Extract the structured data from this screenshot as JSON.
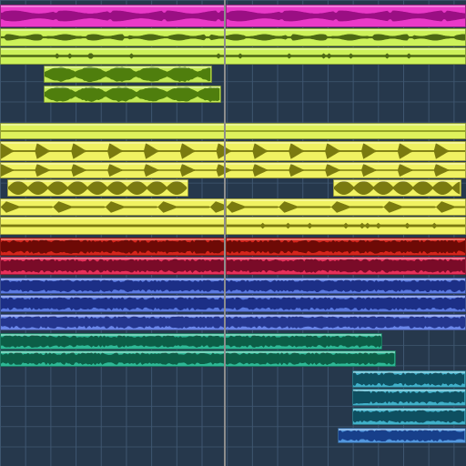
{
  "app": {
    "view": "arrangement",
    "playhead_position": 0.48
  },
  "colors": {
    "background": "#26384c",
    "grid_line": "#3e5670",
    "playhead": "#8d8d8d"
  },
  "tracks": [
    {
      "color": "#ea39c8",
      "wave": "#9a0f83",
      "style": "sustain",
      "regions": [
        {
          "start": 0.0,
          "end": 0.485
        },
        {
          "start": 0.485,
          "end": 1.0
        }
      ]
    },
    {
      "color": "#cdf25a",
      "wave": "#4d6814",
      "style": "flat",
      "regions": [
        {
          "start": 0.0,
          "end": 1.0
        }
      ]
    },
    {
      "color": "#cdf25a",
      "wave": "#4d6814",
      "style": "thin",
      "regions": [
        {
          "start": 0.0,
          "end": 1.0
        }
      ]
    },
    {
      "color": "#c4ea55",
      "wave": "#4f7e0d",
      "style": "blob",
      "regions": [
        {
          "start": 0.093,
          "end": 0.455
        }
      ]
    },
    {
      "color": "#c4ea55",
      "wave": "#4f7e0d",
      "style": "blob",
      "regions": [
        {
          "start": 0.093,
          "end": 0.475
        }
      ]
    },
    {
      "color": "#dff25c",
      "wave": "#7e8d16",
      "style": "empty",
      "regions": [
        {
          "start": 0.0,
          "end": 1.0
        }
      ]
    },
    {
      "color": "#f0f262",
      "wave": "#7a7a10",
      "style": "hits",
      "regions": [
        {
          "start": 0.0,
          "end": 1.0
        }
      ]
    },
    {
      "color": "#f0f262",
      "wave": "#7a7a10",
      "style": "hits",
      "regions": [
        {
          "start": 0.0,
          "end": 1.0
        }
      ]
    },
    {
      "color": "#f0f262",
      "wave": "#7a7a10",
      "style": "shortblob",
      "regions": [
        {
          "start": 0.016,
          "end": 0.405
        },
        {
          "start": 0.715,
          "end": 0.99
        }
      ]
    },
    {
      "color": "#f0f262",
      "wave": "#7a7a10",
      "style": "tails",
      "regions": [
        {
          "start": 0.0,
          "end": 0.485
        },
        {
          "start": 0.485,
          "end": 1.0
        }
      ]
    },
    {
      "color": "#f0f262",
      "wave": "#7a7a10",
      "style": "thin",
      "regions": [
        {
          "start": 0.0,
          "end": 0.485
        },
        {
          "start": 0.485,
          "end": 1.0
        }
      ]
    },
    {
      "color": "#d5251c",
      "wave": "#6e0a06",
      "style": "dense",
      "regions": [
        {
          "start": 0.0,
          "end": 0.485
        },
        {
          "start": 0.485,
          "end": 1.0
        }
      ]
    },
    {
      "color": "#e7305a",
      "wave": "#7a0b28",
      "style": "dense",
      "regions": [
        {
          "start": 0.0,
          "end": 0.485
        },
        {
          "start": 0.485,
          "end": 1.0
        }
      ]
    },
    {
      "color": "#5b7ae0",
      "wave": "#1c2f86",
      "style": "dense",
      "regions": [
        {
          "start": 0.0,
          "end": 1.0
        }
      ]
    },
    {
      "color": "#5b7ae0",
      "wave": "#1c2f86",
      "style": "dense",
      "regions": [
        {
          "start": 0.0,
          "end": 1.0
        }
      ]
    },
    {
      "color": "#6a86e8",
      "wave": "#24368e",
      "style": "dense",
      "regions": [
        {
          "start": 0.0,
          "end": 1.0
        }
      ]
    },
    {
      "color": "#2db895",
      "wave": "#0c5d46",
      "style": "dense",
      "regions": [
        {
          "start": 0.0,
          "end": 0.82
        }
      ]
    },
    {
      "color": "#2db895",
      "wave": "#0c5d46",
      "style": "dense",
      "regions": [
        {
          "start": 0.0,
          "end": 0.85
        }
      ]
    },
    {
      "color": "#40b0c9",
      "wave": "#0e4f60",
      "style": "dense",
      "regions": [
        {
          "start": 0.755,
          "end": 1.0
        }
      ]
    },
    {
      "color": "#40b0c9",
      "wave": "#0e4f60",
      "style": "dense",
      "regions": [
        {
          "start": 0.755,
          "end": 1.0
        }
      ]
    },
    {
      "color": "#40b0c9",
      "wave": "#0e4f60",
      "style": "dense",
      "regions": [
        {
          "start": 0.755,
          "end": 1.0
        }
      ]
    },
    {
      "color": "#5196dd",
      "wave": "#173f8a",
      "style": "dense",
      "regions": [
        {
          "start": 0.725,
          "end": 1.0
        }
      ]
    }
  ]
}
